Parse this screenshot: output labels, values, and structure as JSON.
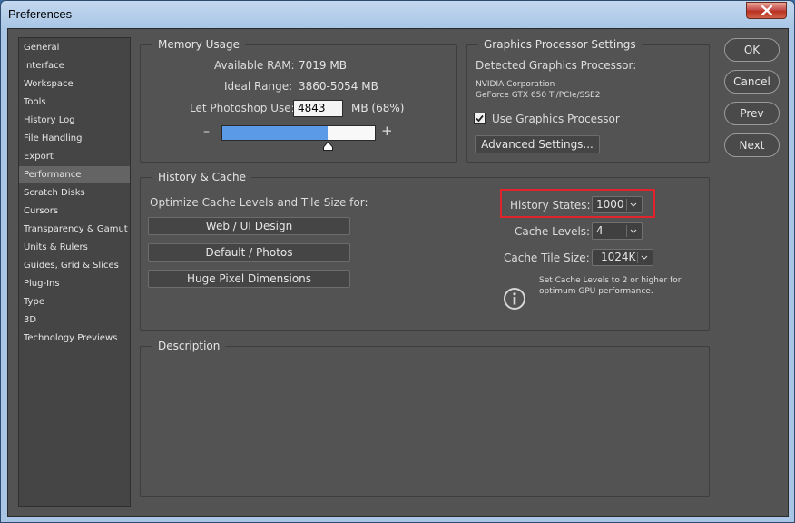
{
  "window": {
    "title": "Preferences"
  },
  "sidebar": {
    "items": [
      {
        "label": "General"
      },
      {
        "label": "Interface"
      },
      {
        "label": "Workspace"
      },
      {
        "label": "Tools"
      },
      {
        "label": "History Log"
      },
      {
        "label": "File Handling"
      },
      {
        "label": "Export"
      },
      {
        "label": "Performance",
        "active": true
      },
      {
        "label": "Scratch Disks"
      },
      {
        "label": "Cursors"
      },
      {
        "label": "Transparency & Gamut"
      },
      {
        "label": "Units & Rulers"
      },
      {
        "label": "Guides, Grid & Slices"
      },
      {
        "label": "Plug-Ins"
      },
      {
        "label": "Type"
      },
      {
        "label": "3D"
      },
      {
        "label": "Technology Previews"
      }
    ]
  },
  "memory": {
    "title": "Memory Usage",
    "available_label": "Available RAM:",
    "available_value": "7019 MB",
    "ideal_label": "Ideal Range:",
    "ideal_value": "3860-5054 MB",
    "let_label": "Let Photoshop Use:",
    "let_value": "4843",
    "let_suffix": "MB (68%)",
    "slider_fraction": 0.69,
    "minus": "–",
    "plus": "+"
  },
  "gpu": {
    "title": "Graphics Processor Settings",
    "detected_label": "Detected Graphics Processor:",
    "vendor": "NVIDIA Corporation",
    "model": "GeForce GTX 650 Ti/PCIe/SSE2",
    "use_gpu_label": "Use Graphics Processor",
    "use_gpu_checked": true,
    "advanced_button": "Advanced Settings..."
  },
  "history_cache": {
    "title": "History & Cache",
    "optimize_label": "Optimize Cache Levels and Tile Size for:",
    "preset_buttons": [
      "Web / UI Design",
      "Default / Photos",
      "Huge Pixel Dimensions"
    ],
    "history_states_label": "History States:",
    "history_states_value": "1000",
    "cache_levels_label": "Cache Levels:",
    "cache_levels_value": "4",
    "cache_tile_label": "Cache Tile Size:",
    "cache_tile_value": "1024K",
    "info_line1": "Set Cache Levels to 2 or higher for",
    "info_line2": "optimum GPU performance.",
    "highlight_color": "#e0242a"
  },
  "description": {
    "title": "Description"
  },
  "actions": {
    "ok": "OK",
    "cancel": "Cancel",
    "prev": "Prev",
    "next": "Next"
  },
  "icons": {
    "close": "close-icon",
    "info": "info-icon",
    "checkbox": "checkmark-icon",
    "chevron": "chevron-down-icon",
    "slider": "slider-thumb-icon"
  }
}
